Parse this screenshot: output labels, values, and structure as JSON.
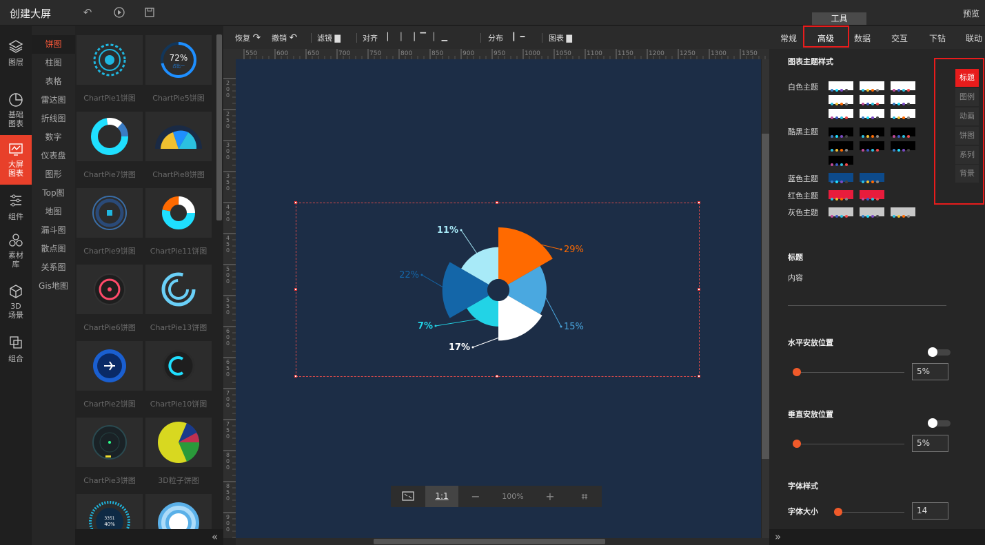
{
  "app": {
    "title": "创建大屏",
    "preview": "预览",
    "tools_tab": "工具"
  },
  "leftbar": [
    {
      "label": "图层",
      "icon": "layers-icon"
    },
    {
      "label": "基础图表",
      "icon": "pie-chart-icon"
    },
    {
      "label": "大屏图表",
      "icon": "screen-chart-icon",
      "active": true
    },
    {
      "label": "组件",
      "icon": "sliders-icon"
    },
    {
      "label": "素材库",
      "icon": "material-icon"
    },
    {
      "label": "3D场景",
      "icon": "cube-icon"
    },
    {
      "label": "组合",
      "icon": "group-icon"
    }
  ],
  "categories": [
    "饼图",
    "柱图",
    "表格",
    "雷达图",
    "折线图",
    "数字",
    "仪表盘",
    "图形",
    "Top图",
    "地图",
    "漏斗图",
    "散点图",
    "关系图",
    "Gis地图"
  ],
  "gallery": [
    "ChartPie1饼图",
    "ChartPie5饼图",
    "ChartPie7饼图",
    "ChartPie8饼图",
    "ChartPie9饼图",
    "ChartPie11饼图",
    "ChartPie6饼图",
    "ChartPie13饼图",
    "ChartPie2饼图",
    "ChartPie10饼图",
    "ChartPie3饼图",
    "3D粒子饼图",
    "",
    ""
  ],
  "gallery_thumb_text": {
    "pct": "72%",
    "sub": "占比一",
    "ring_a": "3351",
    "ring_b": "40%"
  },
  "toolbar": {
    "redo": "恢复",
    "undo": "撤销",
    "filter": "滤镜",
    "align": "对齐",
    "distribute": "分布",
    "chart": "图表"
  },
  "ruler_h": [
    "550",
    "600",
    "650",
    "700",
    "750",
    "800",
    "850",
    "900",
    "950",
    "1000",
    "1050",
    "1100",
    "1150",
    "1200",
    "1250",
    "1300",
    "1350"
  ],
  "ruler_v": [
    "200",
    "250",
    "300",
    "350",
    "400",
    "450",
    "500",
    "550",
    "600",
    "650",
    "700",
    "750",
    "800",
    "850",
    "900"
  ],
  "zoom": {
    "ratio": "1:1",
    "minus": "−",
    "level": "100%",
    "plus": "+"
  },
  "chart_data": {
    "type": "pie",
    "variant": "rose",
    "slices": [
      {
        "label": "29%",
        "value": 29,
        "color": "#ff6a00"
      },
      {
        "label": "15%",
        "value": 15,
        "color": "#4aa8e0"
      },
      {
        "label": "17%",
        "value": 17,
        "color": "#ffffff"
      },
      {
        "label": "7%",
        "value": 7,
        "color": "#22d3e6"
      },
      {
        "label": "22%",
        "value": 22,
        "color": "#1466a8"
      },
      {
        "label": "11%",
        "value": 11,
        "color": "#a8eaf8"
      }
    ]
  },
  "rtabs": [
    "常规",
    "高级",
    "数据",
    "交互",
    "下钻",
    "联动"
  ],
  "right": {
    "theme_section": "图表主题样式",
    "theme_groups": [
      {
        "label": "白色主题",
        "bg": "#ffffff",
        "count": 9
      },
      {
        "label": "酷黑主题",
        "bg": "#000000",
        "count": 7
      },
      {
        "label": "蓝色主题",
        "bg": "#0d4a8a",
        "count": 2
      },
      {
        "label": "红色主题",
        "bg": "#e81c3c",
        "count": 2
      },
      {
        "label": "灰色主题",
        "bg": "#c8c8c8",
        "count": 3
      }
    ],
    "title_section": "标题",
    "content_label": "内容",
    "h_pos_label": "水平安放位置",
    "h_pos_value": "5%",
    "v_pos_label": "垂直安放位置",
    "v_pos_value": "5%",
    "font_section": "字体样式",
    "font_size_label": "字体大小",
    "font_size_value": "14"
  },
  "sidetabs": [
    "标题",
    "图例",
    "动画",
    "饼图",
    "系列",
    "背景"
  ]
}
